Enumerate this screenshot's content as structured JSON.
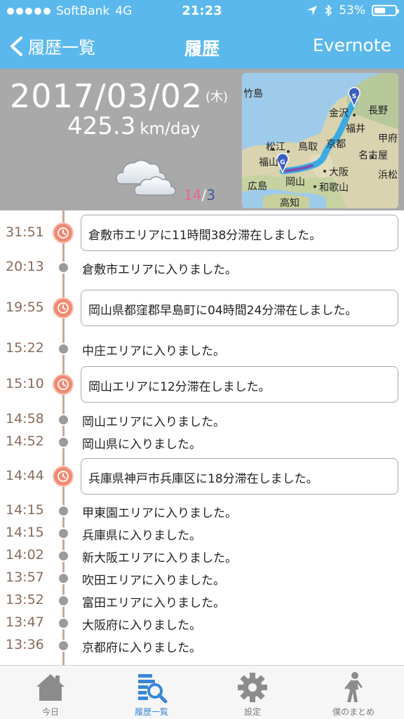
{
  "status_bar": {
    "carrier": "SoftBank",
    "network": "4G",
    "time": "21:23",
    "battery": "53%",
    "battery_level": 0.53
  },
  "nav": {
    "back_label": "履歴一覧",
    "title": "履歴",
    "action_label": "Evernote"
  },
  "summary": {
    "date": "2017/03/02",
    "weekday": "(木)",
    "speed_value": "425.3",
    "speed_unit": "km/day",
    "page_current": "14",
    "page_separator": "/",
    "page_total": "3",
    "weather_icon": "cloudy-icon"
  },
  "map": {
    "labels": [
      "竹島",
      "金沢",
      "長野",
      "福井",
      "甲府",
      "松江",
      "鳥取",
      "京都",
      "名古屋",
      "福山",
      "浜松",
      "広島",
      "岡山",
      "大阪",
      "和歌山",
      "高知"
    ],
    "start_marker": "S",
    "goal_marker": "G"
  },
  "timeline": [
    {
      "time": "31:51",
      "type": "stay",
      "text": "倉敷市エリアに11時間38分滞在しました。"
    },
    {
      "time": "20:13",
      "type": "enter",
      "text": "倉敷市エリアに入りました。"
    },
    {
      "time": "19:55",
      "type": "stay",
      "text": "岡山県都窪郡早島町に04時間24分滞在しました。"
    },
    {
      "time": "15:22",
      "type": "enter",
      "text": "中庄エリアに入りました。"
    },
    {
      "time": "15:10",
      "type": "stay",
      "text": "岡山エリアに12分滞在しました。"
    },
    {
      "time": "14:58",
      "type": "enter",
      "text": "岡山エリアに入りました。"
    },
    {
      "time": "14:52",
      "type": "enter",
      "text": "岡山県に入りました。"
    },
    {
      "time": "14:44",
      "type": "stay",
      "text": "兵庫県神戸市兵庫区に18分滞在しました。"
    },
    {
      "time": "14:15",
      "type": "enter",
      "text": "甲東園エリアに入りました。"
    },
    {
      "time": "14:15",
      "type": "enter",
      "text": "兵庫県に入りました。"
    },
    {
      "time": "14:02",
      "type": "enter",
      "text": "新大阪エリアに入りました。"
    },
    {
      "time": "13:57",
      "type": "enter",
      "text": "吹田エリアに入りました。"
    },
    {
      "time": "13:52",
      "type": "enter",
      "text": "富田エリアに入りました。"
    },
    {
      "time": "13:47",
      "type": "enter",
      "text": "大阪府に入りました。"
    },
    {
      "time": "13:36",
      "type": "enter",
      "text": "京都府に入りました。"
    }
  ],
  "tabs": [
    {
      "label": "今日",
      "icon": "home-icon",
      "active": false
    },
    {
      "label": "履歴一覧",
      "icon": "history-list-icon",
      "active": true
    },
    {
      "label": "設定",
      "icon": "gear-icon",
      "active": false
    },
    {
      "label": "僕のまとめ",
      "icon": "walking-person-icon",
      "active": false
    }
  ],
  "colors": {
    "header": "#5bb8ec",
    "summary_bg": "#aaa9a9",
    "stay_icon": "#f08a73",
    "enter_dot": "#9b9b9b",
    "timeline_line": "#c9a99a",
    "active_tab": "#3a86d8",
    "route": "#2aa6e8"
  }
}
